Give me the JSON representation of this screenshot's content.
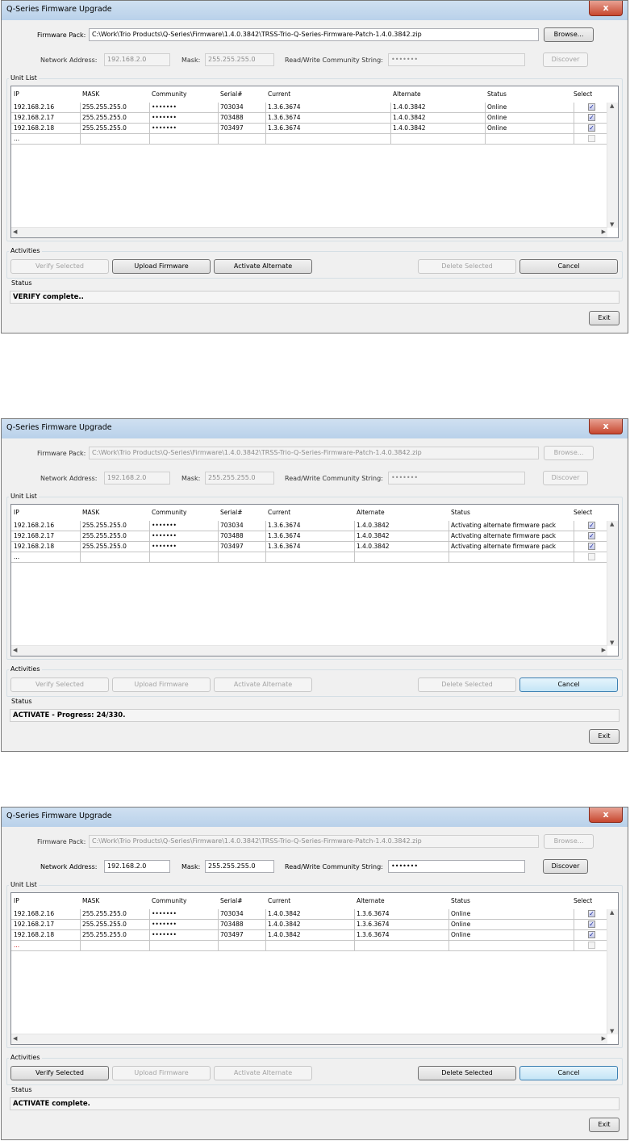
{
  "windows": [
    {
      "title": "Q-Series Firmware Upgrade",
      "close_label": "x",
      "firmware_label": "Firmware Pack:",
      "firmware_value": "C:\\Work\\Trio Products\\Q-Series\\Firmware\\1.4.0.3842\\TRSS-Trio-Q-Series-Firmware-Patch-1.4.0.3842.zip",
      "browse_label": "Browse...",
      "network_label": "Network Address:",
      "network_value": "192.168.2.0",
      "mask_label": "Mask:",
      "mask_value": "255.255.255.0",
      "community_label": "Read/Write Community String:",
      "community_value": "•••••••",
      "discover_label": "Discover",
      "unit_list_label": "Unit List",
      "columns": [
        "IP",
        "MASK",
        "Community",
        "Serial#",
        "Current",
        "Alternate",
        "Status",
        "Select"
      ],
      "rows": [
        {
          "ip": "192.168.2.16",
          "mask": "255.255.255.0",
          "community": "•••••••",
          "serial": "703034",
          "current": "1.3.6.3674",
          "alternate": "1.4.0.3842",
          "status": "Online"
        },
        {
          "ip": "192.168.2.17",
          "mask": "255.255.255.0",
          "community": "•••••••",
          "serial": "703488",
          "current": "1.3.6.3674",
          "alternate": "1.4.0.3842",
          "status": "Online"
        },
        {
          "ip": "192.168.2.18",
          "mask": "255.255.255.0",
          "community": "•••••••",
          "serial": "703497",
          "current": "1.3.6.3674",
          "alternate": "1.4.0.3842",
          "status": "Online"
        }
      ],
      "new_row": "...",
      "activities_label": "Activities",
      "verify_label": "Verify Selected",
      "upload_label": "Upload Firmware",
      "activate_label": "Activate Alternate",
      "delete_label": "Delete Selected",
      "cancel_label": "Cancel",
      "status_label": "Status",
      "status_text": "VERIFY complete..",
      "exit_label": "Exit"
    },
    {
      "title": "Q-Series Firmware Upgrade",
      "close_label": "x",
      "firmware_label": "Firmware Pack:",
      "firmware_value": "C:\\Work\\Trio Products\\Q-Series\\Firmware\\1.4.0.3842\\TRSS-Trio-Q-Series-Firmware-Patch-1.4.0.3842.zip",
      "browse_label": "Browse...",
      "network_label": "Network Address:",
      "network_value": "192.168.2.0",
      "mask_label": "Mask:",
      "mask_value": "255.255.255.0",
      "community_label": "Read/Write Community String:",
      "community_value": "•••••••",
      "discover_label": "Discover",
      "unit_list_label": "Unit List",
      "columns": [
        "IP",
        "MASK",
        "Community",
        "Serial#",
        "Current",
        "Alternate",
        "Status",
        "Select"
      ],
      "rows": [
        {
          "ip": "192.168.2.16",
          "mask": "255.255.255.0",
          "community": "•••••••",
          "serial": "703034",
          "current": "1.3.6.3674",
          "alternate": "1.4.0.3842",
          "status": "Activating alternate firmware pack"
        },
        {
          "ip": "192.168.2.17",
          "mask": "255.255.255.0",
          "community": "•••••••",
          "serial": "703488",
          "current": "1.3.6.3674",
          "alternate": "1.4.0.3842",
          "status": "Activating alternate firmware pack"
        },
        {
          "ip": "192.168.2.18",
          "mask": "255.255.255.0",
          "community": "•••••••",
          "serial": "703497",
          "current": "1.3.6.3674",
          "alternate": "1.4.0.3842",
          "status": "Activating alternate firmware pack"
        }
      ],
      "new_row": "...",
      "activities_label": "Activities",
      "verify_label": "Verify Selected",
      "upload_label": "Upload Firmware",
      "activate_label": "Activate Alternate",
      "delete_label": "Delete Selected",
      "cancel_label": "Cancel",
      "status_label": "Status",
      "status_text": "ACTIVATE - Progress: 24/330.",
      "exit_label": "Exit"
    },
    {
      "title": "Q-Series Firmware Upgrade",
      "close_label": "x",
      "firmware_label": "Firmware Pack:",
      "firmware_value": "C:\\Work\\Trio Products\\Q-Series\\Firmware\\1.4.0.3842\\TRSS-Trio-Q-Series-Firmware-Patch-1.4.0.3842.zip",
      "browse_label": "Browse...",
      "network_label": "Network Address:",
      "network_value": "192.168.2.0",
      "mask_label": "Mask:",
      "mask_value": "255.255.255.0",
      "community_label": "Read/Write Community String:",
      "community_value": "•••••••",
      "discover_label": "Discover",
      "unit_list_label": "Unit List",
      "columns": [
        "IP",
        "MASK",
        "Community",
        "Serial#",
        "Current",
        "Alternate",
        "Status",
        "Select"
      ],
      "rows": [
        {
          "ip": "192.168.2.16",
          "mask": "255.255.255.0",
          "community": "•••••••",
          "serial": "703034",
          "current": "1.4.0.3842",
          "alternate": "1.3.6.3674",
          "status": "Online"
        },
        {
          "ip": "192.168.2.17",
          "mask": "255.255.255.0",
          "community": "•••••••",
          "serial": "703488",
          "current": "1.4.0.3842",
          "alternate": "1.3.6.3674",
          "status": "Online"
        },
        {
          "ip": "192.168.2.18",
          "mask": "255.255.255.0",
          "community": "•••••••",
          "serial": "703497",
          "current": "1.4.0.3842",
          "alternate": "1.3.6.3674",
          "status": "Online"
        }
      ],
      "new_row": "...",
      "activities_label": "Activities",
      "verify_label": "Verify Selected",
      "upload_label": "Upload Firmware",
      "activate_label": "Activate Alternate",
      "delete_label": "Delete Selected",
      "cancel_label": "Cancel",
      "status_label": "Status",
      "status_text": "ACTIVATE complete.",
      "exit_label": "Exit"
    }
  ]
}
